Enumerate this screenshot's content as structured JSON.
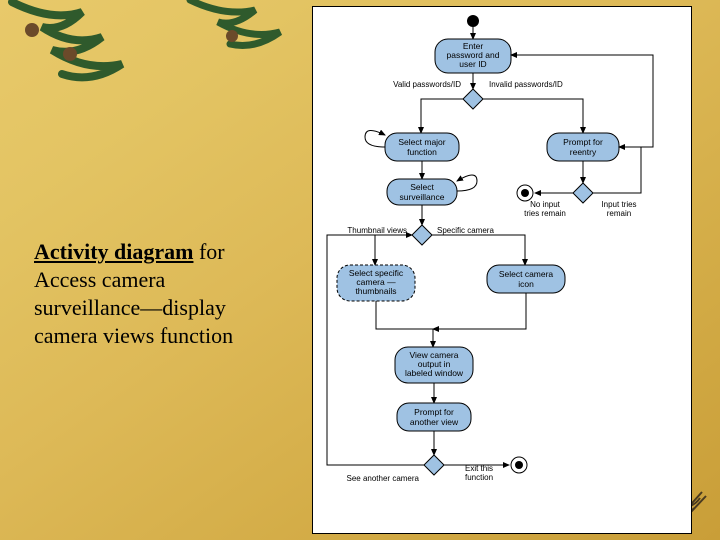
{
  "caption": {
    "bold_underlined": "Activity diagram",
    "rest": " for Access camera surveillance—display camera views function"
  },
  "diagram": {
    "nodes": {
      "start": "initial",
      "enter_pw": {
        "l1": "Enter",
        "l2": "password and",
        "l3": "user ID"
      },
      "dec_valid": "decision",
      "label_valid": "Valid passwords/ID",
      "label_invalid": "Invalid passwords/ID",
      "select_major": {
        "l1": "Select major",
        "l2": "function"
      },
      "prompt_reentry": {
        "l1": "Prompt for",
        "l2": "reentry"
      },
      "dec_reentry": "decision",
      "label_no_input": {
        "l1": "No input",
        "l2": "tries remain"
      },
      "label_input_remain": {
        "l1": "Input tries",
        "l2": "remain"
      },
      "final_reentry": "final",
      "select_surv": {
        "l1": "Select",
        "l2": "surveillance"
      },
      "dec_views": "decision",
      "label_thumb": "Thumbnail views",
      "label_spec": "Specific camera",
      "sel_thumbs": {
        "l1": "Select specific",
        "l2": "camera —",
        "l3": "thumbnails"
      },
      "sel_icon": {
        "l1": "Select camera",
        "l2": "icon"
      },
      "view_output": {
        "l1": "View camera",
        "l2": "output in",
        "l3": "labeled window"
      },
      "prompt_another": {
        "l1": "Prompt for",
        "l2": "another view"
      },
      "dec_exit": "decision",
      "label_see_another": "See another camera",
      "label_exit": {
        "l1": "Exit this",
        "l2": "function"
      },
      "final_exit": "final"
    },
    "edges": [
      "start->enter_pw",
      "enter_pw->dec_valid",
      "dec_valid->select_major (valid)",
      "dec_valid->prompt_reentry (invalid)",
      "prompt_reentry->dec_reentry",
      "dec_reentry->enter_pw (input tries remain)",
      "dec_reentry->final_reentry (no input tries remain)",
      "select_major->select_surv",
      "select_major(loop other functions)->select_major",
      "select_surv->dec_views",
      "select_surv(loop other surveillance)->select_surv",
      "dec_views->sel_thumbs (thumbnail)",
      "dec_views->sel_icon (specific)",
      "sel_thumbs->view_output",
      "sel_icon->view_output",
      "view_output->prompt_another",
      "prompt_another->dec_exit",
      "dec_exit->final_exit (exit)",
      "dec_exit->select_surv-dec_views loop (see another)"
    ]
  }
}
